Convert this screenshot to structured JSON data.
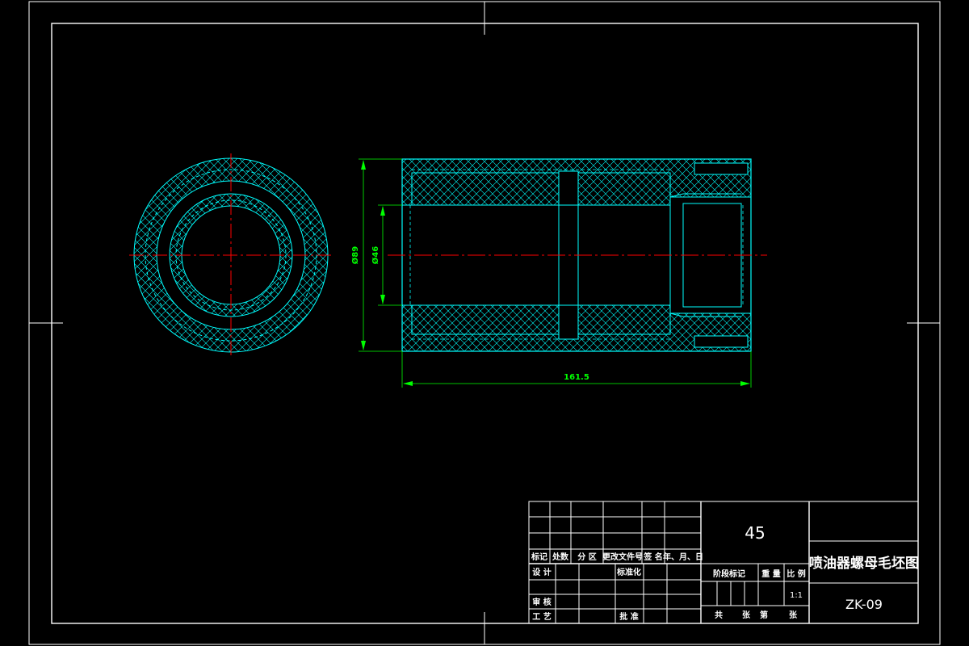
{
  "drawing": {
    "dimensions": {
      "outer_diameter": "Ø89",
      "inner_diameter": "Ø46",
      "length": "161.5"
    },
    "colors": {
      "background": "#000000",
      "frame": "#ffffff",
      "part_outline": "#00ffff",
      "centerline": "#ff0000",
      "dimension": "#00ff00"
    }
  },
  "title_block": {
    "material": "45",
    "drawing_title": "喷油器螺母毛坯图",
    "drawing_code": "ZK-09",
    "scale": "1:1",
    "revision_headers": {
      "mark": "标记",
      "count": "处数",
      "zone": "分 区",
      "doc_no": "更改文件号",
      "sign": "签 名",
      "date": "年、月、日"
    },
    "roles": {
      "design": "设 计",
      "standardize": "标准化",
      "review": "审 核",
      "process": "工 艺",
      "approve": "批 准"
    },
    "stage_headers": {
      "stage_mark": "阶段标记",
      "weight": "重 量",
      "scale_label": "比 例"
    },
    "sheet_footer": {
      "total": "共",
      "sheets1": "张",
      "number": "第",
      "sheets2": "张"
    }
  }
}
